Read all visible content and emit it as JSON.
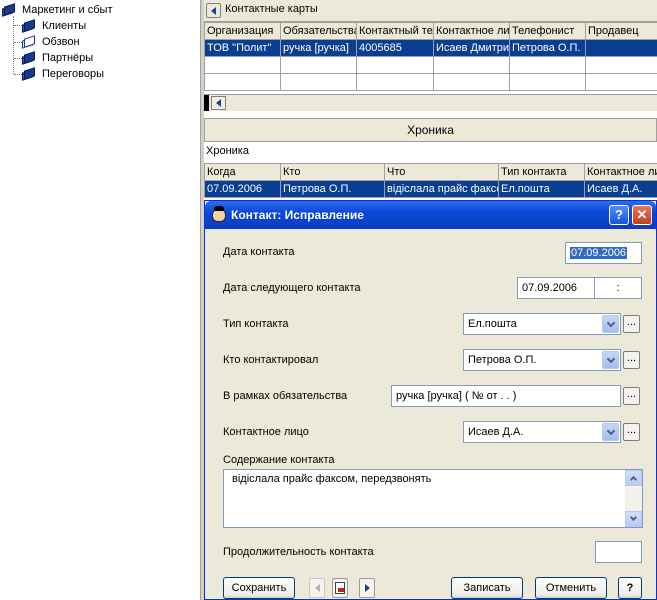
{
  "tree": {
    "root": "Маркетинг и сбыт",
    "items": [
      "Клиенты",
      "Обзвон",
      "Партнёры",
      "Переговоры"
    ]
  },
  "cards_pane": {
    "title": "Контактные карты",
    "columns": [
      "Организация",
      "Обязательства",
      "Контактный телефон",
      "Контактное лицо",
      "Телефонист",
      "Продавец"
    ],
    "rows": [
      [
        "ТОВ \"Полит\"",
        "ручка [ручка]",
        "4005685",
        "Исаев Дмитрий",
        "Петрова О.П.",
        ""
      ]
    ]
  },
  "chronicle": {
    "section_title": "Хроника",
    "sub_label": "Хроника",
    "columns": [
      "Когда",
      "Кто",
      "Что",
      "Тип контакта",
      "Контактное лицо"
    ],
    "rows": [
      [
        "07.09.2006",
        "Петрова О.П.",
        "відіслала прайс факсом, передзвонять",
        "Ел.пошта",
        "Исаев Д.А."
      ]
    ]
  },
  "dialog": {
    "title": "Контакт: Исправление",
    "help_glyph": "?",
    "close_glyph": "✕",
    "date_label": "Дата контакта",
    "date_value": "07.09.2006",
    "next_date_label": "Дата следующего контакта",
    "next_date_value": "07.09.2006",
    "next_time_value": ":",
    "type_label": "Тип контакта",
    "type_value": "Ел.пошта",
    "who_label": "Кто контактировал",
    "who_value": "Петрова О.П.",
    "obligation_label": "В рамках обязательства",
    "obligation_value": "ручка [ручка] ( №  от   .  .   )",
    "person_label": "Контактное лицо",
    "person_value": "Исаев Д.А.",
    "content_label": "Содержание контакта",
    "content_value": "відіслала прайс факсом, передзвонять",
    "duration_label": "Продолжительность контакта",
    "duration_value": "",
    "ellipsis": "...",
    "save_label": "Сохранить",
    "record_label": "Записать",
    "cancel_label": "Отменить",
    "help_label": "?"
  }
}
